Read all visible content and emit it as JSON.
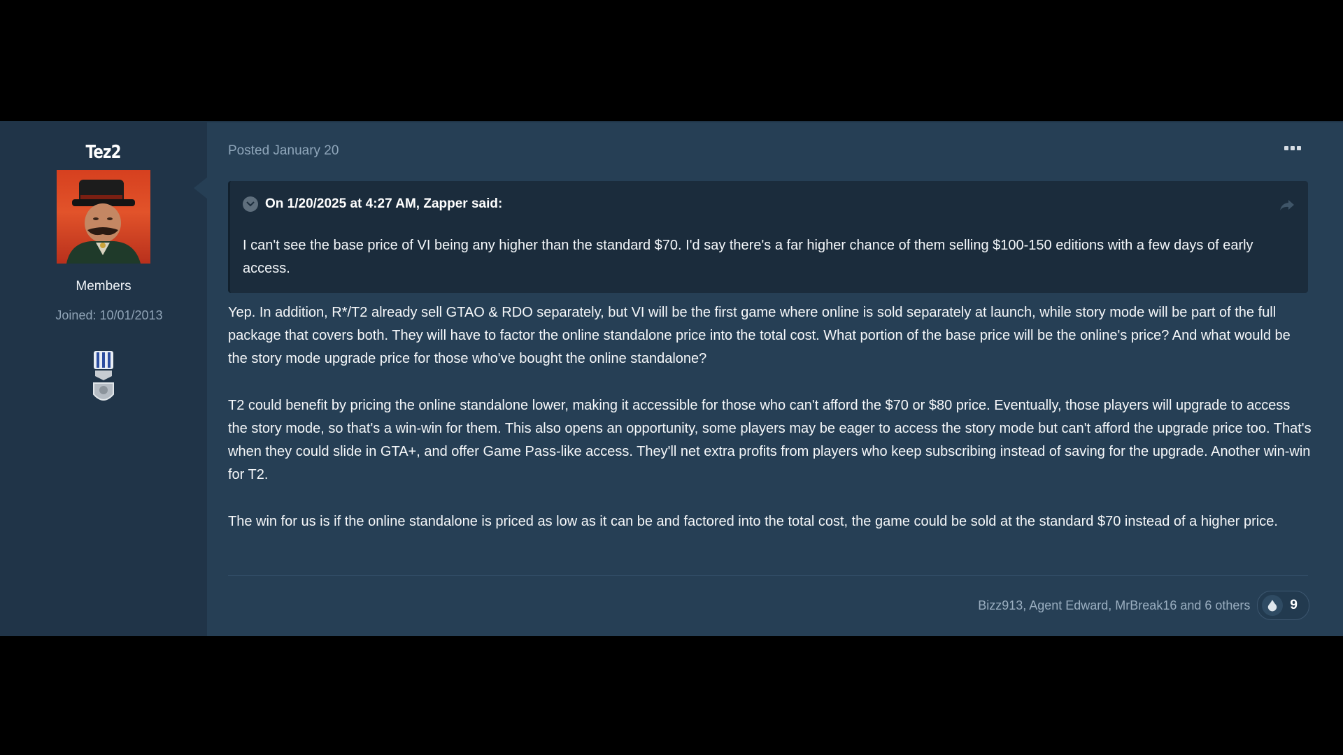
{
  "author": {
    "name": "Tez2",
    "group": "Members",
    "joined": "Joined: 10/01/2013"
  },
  "post": {
    "posted": "Posted January 20",
    "quote": {
      "header": "On 1/20/2025 at 4:27 AM, Zapper said:",
      "body": "I can't see the base price of VI being any higher than the standard $70. I'd say there's a far higher chance of them selling $100-150 editions with a few days of early access."
    },
    "paragraphs": [
      "Yep. In addition, R*/T2 already sell GTAO & RDO separately, but VI will be the first game where online is sold separately at launch, while story mode will be part of the full package that covers both. They will have to factor the online standalone price into the total cost. What portion of the base price will be the online's price? And what would be the story mode upgrade price for those who've bought the online standalone?",
      "T2 could benefit by pricing the online standalone lower, making it accessible for those who can't afford the $70 or $80 price. Eventually, those players will upgrade to access the story mode, so that's a win-win for them. This also opens an opportunity, some players may be eager to access the story mode but can't afford the upgrade price too. That's when they could slide in GTA+, and offer Game Pass-like access. They'll net extra profits from players who keep subscribing instead of saving for the upgrade. Another win-win for T2.",
      "The win for us is if the online standalone is priced as low as it can be and factored into the total cost, the game could be sold at the standard $70 instead of a higher price."
    ],
    "reactions": {
      "names": "Bizz913, Agent Edward, MrBreak16 and 6 others",
      "count": "9",
      "icon": "reaction-icon"
    }
  },
  "icons": {
    "more": "more-options-icon",
    "collapse": "collapse-quote-icon",
    "share": "share-icon",
    "badge": "rank-badge-icon"
  },
  "colors": {
    "page_background": "#000000",
    "author_panel": "#203448",
    "content_panel": "#263f55",
    "quote_background": "#1b2c3c",
    "meta_text": "#8fa6ba"
  }
}
